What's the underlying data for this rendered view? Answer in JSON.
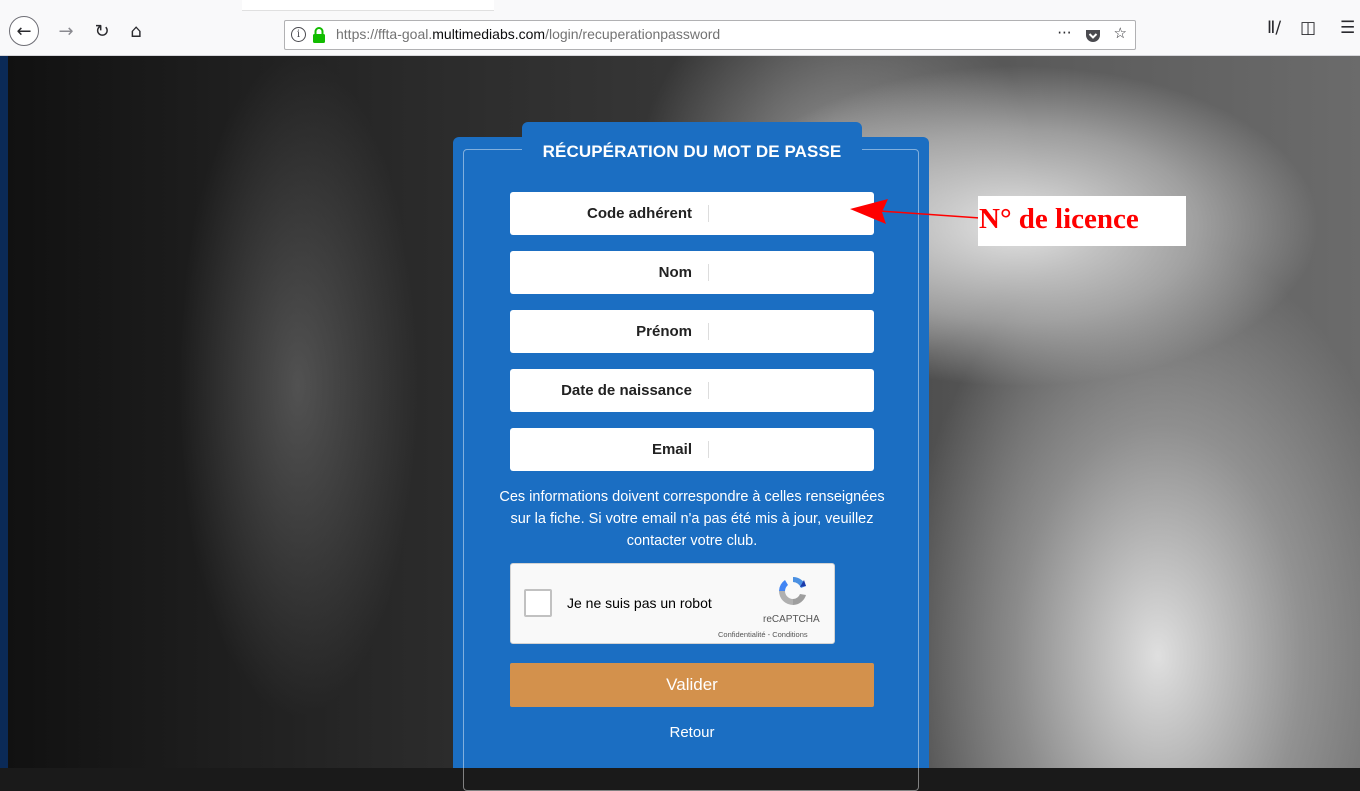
{
  "browser": {
    "url_prefix": "https://ffta-goal.",
    "url_host": "multimediabs.com",
    "url_path": "/login/recuperationpassword",
    "url_more": "···",
    "icons": [
      "back-icon",
      "forward-icon",
      "reload-icon",
      "home-icon",
      "info-icon",
      "lock-icon",
      "pocket-icon",
      "bookmark-star-icon",
      "library-icon",
      "sidebar-icon",
      "menu-icon"
    ]
  },
  "form": {
    "title": "RÉCUPÉRATION DU MOT DE PASSE",
    "fields": [
      {
        "label": "Code adhérent",
        "value": ""
      },
      {
        "label": "Nom",
        "value": ""
      },
      {
        "label": "Prénom",
        "value": ""
      },
      {
        "label": "Date de naissance",
        "value": ""
      },
      {
        "label": "Email",
        "value": ""
      }
    ],
    "info": "Ces informations doivent correspondre à celles renseignées sur la fiche. Si votre email n'a pas été mis à jour, veuillez contacter votre club.",
    "captcha": {
      "label": "Je ne suis pas un robot",
      "brand": "reCAPTCHA",
      "links": "Confidentialité - Conditions"
    },
    "submit": "Valider",
    "back": "Retour"
  },
  "annotation": {
    "text": "N° de licence",
    "color": "#ff0000"
  },
  "colors": {
    "card_blue": "#1b6ec2",
    "button_orange": "#d3914c"
  }
}
